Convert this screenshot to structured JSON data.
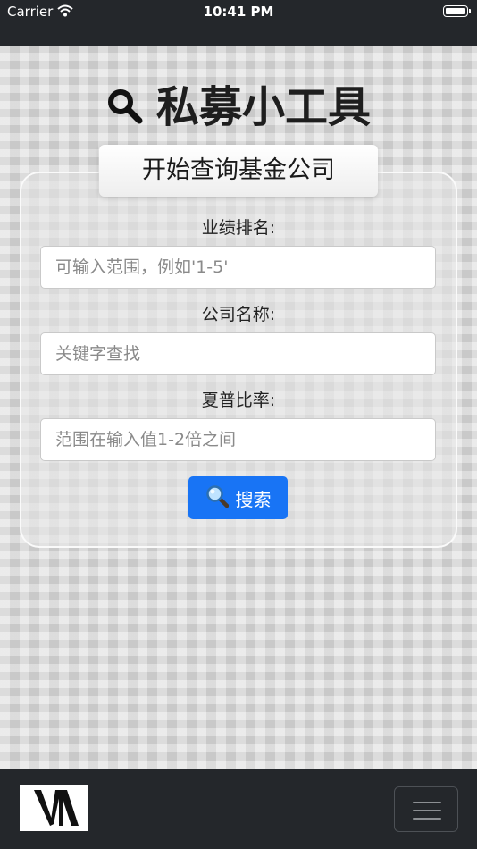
{
  "status_bar": {
    "carrier": "Carrier",
    "time": "10:41 PM"
  },
  "header": {
    "title": "私募小工具",
    "icon": "search-icon"
  },
  "panel": {
    "heading": "开始查询基金公司",
    "fields": [
      {
        "label": "业绩排名:",
        "placeholder": "可输入范围，例如'1-5'",
        "value": ""
      },
      {
        "label": "公司名称:",
        "placeholder": "关键字查找",
        "value": ""
      },
      {
        "label": "夏普比率:",
        "placeholder": "范围在输入值1-2倍之间",
        "value": ""
      }
    ],
    "search_button": {
      "label": "搜索",
      "icon": "magnifier-emoji-icon"
    }
  },
  "navbar": {
    "logo": "VA",
    "menu_icon": "hamburger-icon"
  },
  "colors": {
    "accent": "#1874f5",
    "bar": "#24272b",
    "background": "#dcdcdc"
  }
}
